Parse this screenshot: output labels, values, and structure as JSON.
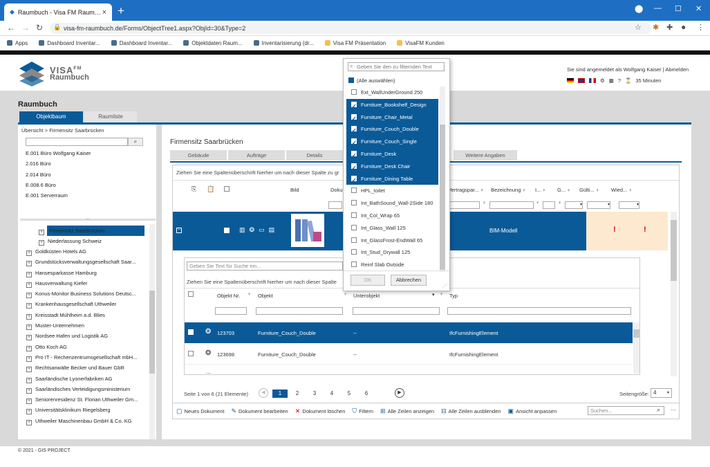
{
  "browser": {
    "tab_title": "Raumbuch - Visa FM Raumbuch",
    "url": "visa-fm-raumbuch.de/Forms/ObjectTree1.aspx?ObjId=30&Type=2",
    "bookmarks": [
      "Apps",
      "Dashboard Inventar...",
      "Dashboard Inventar...",
      "Objektdaten Raum...",
      "Inventarisierung (dr...",
      "Visa FM Präsentation",
      "VisaFM Kunden"
    ]
  },
  "header": {
    "logo_main": "VISA",
    "logo_sup": "FM",
    "logo_sub": "Raumbuch",
    "user_text": "Sie sind angemeldet als Wolfgang Kaiser",
    "logout": "Abmelden",
    "timer": "35 Minuten"
  },
  "page": {
    "title": "Raumbuch",
    "tab_objektbaum": "Objektbaum",
    "tab_raumliste": "Raumliste",
    "breadcrumb": "Übersicht > Firmensitz Saarbrücken",
    "footer": "© 2021 - GIS PROJECT"
  },
  "recent": [
    "E.001 Büro Wolfgang Kaiser",
    "2.016 Büro",
    "2.014 Büro",
    "E.008.6 Büro",
    "E.001 Serverraum"
  ],
  "tree_top": [
    "Firmensitz Saarbrücken",
    "Niederlassung Schweiz"
  ],
  "tree": [
    "Goldküsten Hotels AG",
    "Grundstücksverwaltungsgesellschaft Saar...",
    "Hansesparkasse Hamburg",
    "Hausverwaltung Kiefer",
    "Konus-Monitor Business Solutions Deutsc...",
    "Krankenhausgesellschaft Uthweiler",
    "Kreisstadt Mühlheim a.d. Blies",
    "Muster-Unternehmen",
    "Nordsee Hafen und Logistik AG",
    "Otto Koch AG",
    "Pro IT - Rechenzentrumsgesellschaft mbH...",
    "Rechtsanwälte Becker und Bauer GbR",
    "Saarländische Lyonerfabriken AG",
    "Saarländisches Verteidigungsministerium",
    "Seniorenresidenz St. Florian Uthweiler Gm...",
    "Universitätsklinikum Riegelsberg",
    "Uthweiler Maschinenbau GmbH & Co. KG"
  ],
  "main": {
    "title": "Firmensitz Saarbrücken",
    "tabs": [
      "Gebäude",
      "Aufträge",
      "Details",
      "Weitere Angaben"
    ],
    "group_hint": "Ziehen Sie eine Spaltenüberschrift hierher um nach dieser Spalte zu gr",
    "col_bild": "Bild",
    "col_doku": "Doku",
    "cols_right": [
      "Vertragspar...",
      "Bezeichnung",
      "I...",
      "G...",
      "Gülti...",
      "Wied..."
    ],
    "row_label": "BIM-Modell",
    "alert": "!"
  },
  "inner": {
    "search_placeholder": "Geben Sie Text für Suche ein...",
    "group_hint": "Ziehen Sie eine Spaltenüberschrift hierher um nach dieser Spalte",
    "cols": [
      "Objekt Nr.",
      "Objekt",
      "Unterobjekt",
      "Typ"
    ],
    "rows": [
      {
        "nr": "123703",
        "objekt": "Furniture_Couch_Double",
        "unter": "--",
        "typ": "IfcFurnishingElement"
      },
      {
        "nr": "123698",
        "objekt": "Furniture_Couch_Double",
        "unter": "--",
        "typ": "IfcFurnishingElement"
      }
    ],
    "more": "..."
  },
  "pager": {
    "info": "Seite 1 von 6 (21 Elemente)",
    "pages": [
      "1",
      "2",
      "3",
      "4",
      "5",
      "6"
    ],
    "size_label": "Seitengröße:",
    "size": "4"
  },
  "toolbar": {
    "items": [
      "Neues Dokument",
      "Dokument bearbeiten",
      "Dokument löschen",
      "Filtern",
      "Alle Zeilen anzeigen",
      "Alle Zeilen ausblenden",
      "Ansicht anpassen"
    ],
    "search_placeholder": "Suchen..."
  },
  "filter": {
    "placeholder": "Geben Sie den zu filternden Text",
    "select_all": "(Alle auswählen)",
    "items": [
      {
        "label": "Ext_WallUnderGround 250",
        "checked": false
      },
      {
        "label": "Furniture_Bookshelf_Design",
        "checked": true
      },
      {
        "label": "Furniture_Chair_Metal",
        "checked": true
      },
      {
        "label": "Furniture_Couch_Double",
        "checked": true
      },
      {
        "label": "Furniture_Couch_Single",
        "checked": true
      },
      {
        "label": "Furniture_Desk",
        "checked": true
      },
      {
        "label": "Furniture_Desk Chair",
        "checked": true
      },
      {
        "label": "Furniture_Dining Table",
        "checked": true
      },
      {
        "label": "HPL_toilet",
        "checked": false
      },
      {
        "label": "Int_BathSound_Wall-2Side 180",
        "checked": false
      },
      {
        "label": "Int_Col_Wrap 65",
        "checked": false
      },
      {
        "label": "Int_Glass_Wall 125",
        "checked": false
      },
      {
        "label": "Int_GlassFrost-EndWall 65",
        "checked": false
      },
      {
        "label": "Int_Stud_Drywall 125",
        "checked": false
      },
      {
        "label": "Reinf Slab Outside",
        "checked": false
      }
    ],
    "ok": "OK",
    "cancel": "Abbrechen"
  },
  "colors": {
    "accent": "#0a5a98",
    "chrome": "#1e6fc4",
    "alert": "#e00000",
    "highlight": "#fde9d0"
  }
}
